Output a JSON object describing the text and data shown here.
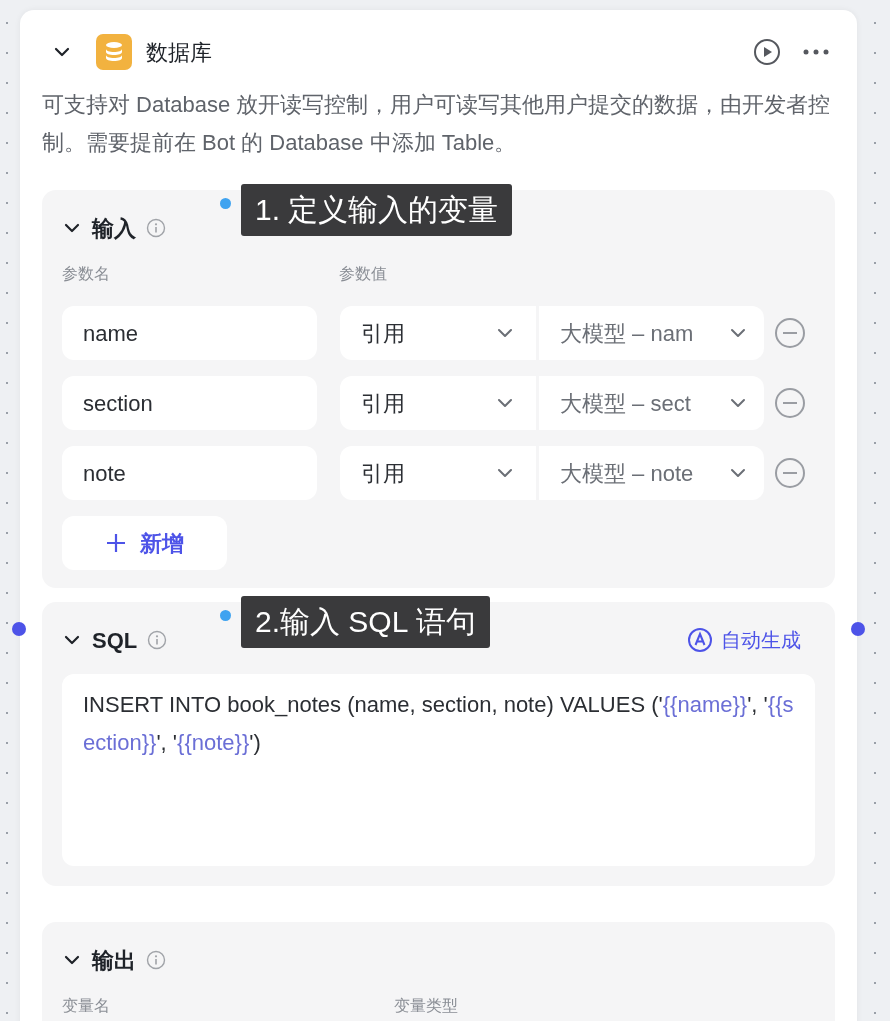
{
  "node": {
    "title": "数据库",
    "expanded": true,
    "description": "可支持对 Database 放开读写控制，用户可读写其他用户提交的数据，由开发者控制。需要提前在 Bot 的 Database 中添加 Table。"
  },
  "input": {
    "title": "输入",
    "expanded": true,
    "callout": "1. 定义输入的变量",
    "columns": [
      "参数名",
      "参数值"
    ],
    "rows": [
      {
        "name": "name",
        "source": "引用",
        "value": "大模型 – nam"
      },
      {
        "name": "section",
        "source": "引用",
        "value": "大模型 – sect"
      },
      {
        "name": "note",
        "source": "引用",
        "value": "大模型 – note"
      }
    ],
    "add_button": "新增"
  },
  "sql": {
    "title": "SQL",
    "expanded": true,
    "callout": "2.输入 SQL 语句",
    "auto_button": "自动生成",
    "segments": [
      {
        "kind": "plain",
        "text": "INSERT INTO book_notes (name, section, note) VALUES ('"
      },
      {
        "kind": "variable",
        "text": "{{name}}"
      },
      {
        "kind": "plain",
        "text": "', '"
      },
      {
        "kind": "variable",
        "text": "{{section}}"
      },
      {
        "kind": "plain",
        "text": "', '"
      },
      {
        "kind": "variable",
        "text": "{{note}}"
      },
      {
        "kind": "plain",
        "text": "')"
      }
    ]
  },
  "output": {
    "title": "输出",
    "expanded": true,
    "columns": [
      "变量名",
      "变量类型"
    ]
  }
}
